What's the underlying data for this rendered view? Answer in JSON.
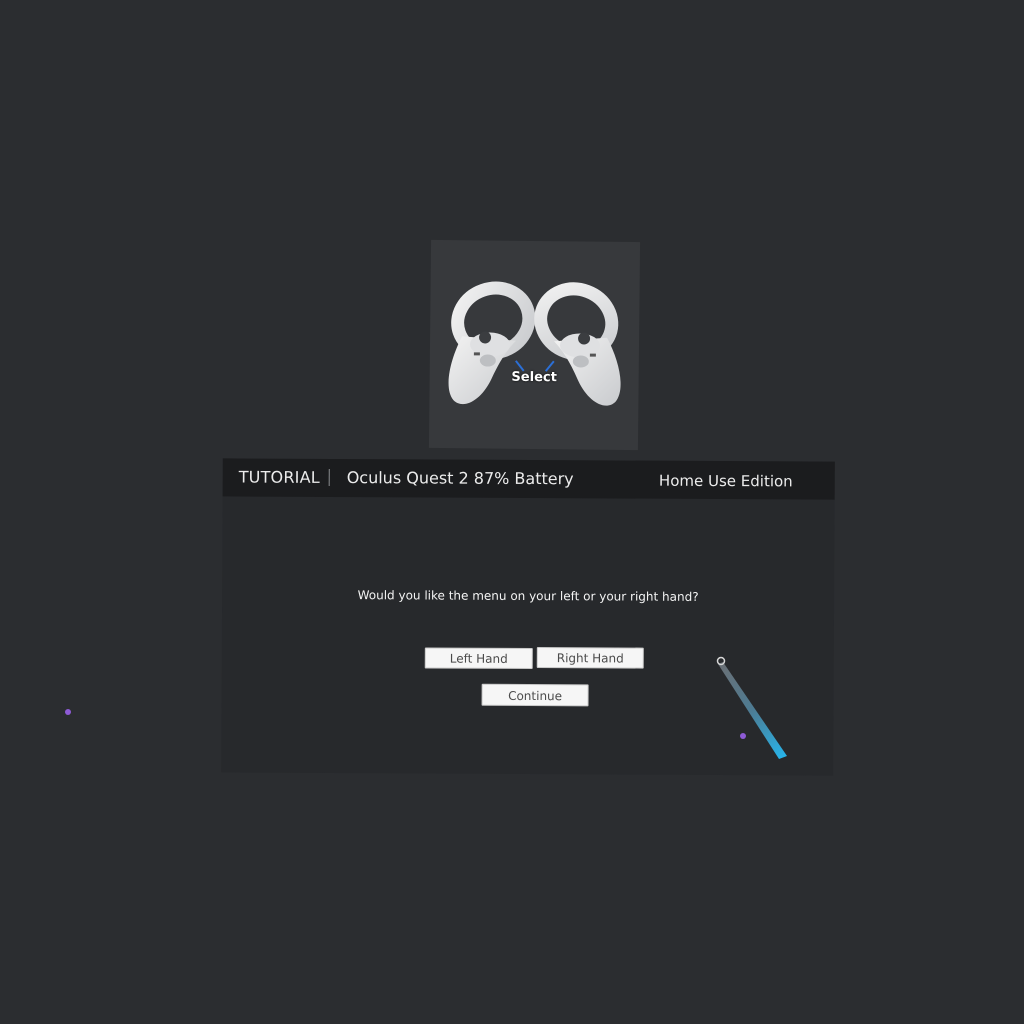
{
  "hint": {
    "image": "oculus-touch-controllers",
    "label": "Select"
  },
  "header": {
    "title": "TUTORIAL",
    "device_status": "Oculus Quest 2 87% Battery",
    "edition": "Home Use Edition"
  },
  "prompt": {
    "question": "Would you like the menu on your left or your right hand?"
  },
  "buttons": {
    "left_hand": "Left Hand",
    "right_hand": "Right Hand",
    "continue": "Continue"
  },
  "colors": {
    "background": "#2b2d30",
    "panel": "#27292c",
    "header": "#1b1c1e",
    "laser": "#27b4ea",
    "cursor_dot": "#8e5bd6"
  },
  "icons": {
    "laser_pointer": "laser-pointer-icon",
    "cursor_dot": "cursor-dot-icon"
  }
}
